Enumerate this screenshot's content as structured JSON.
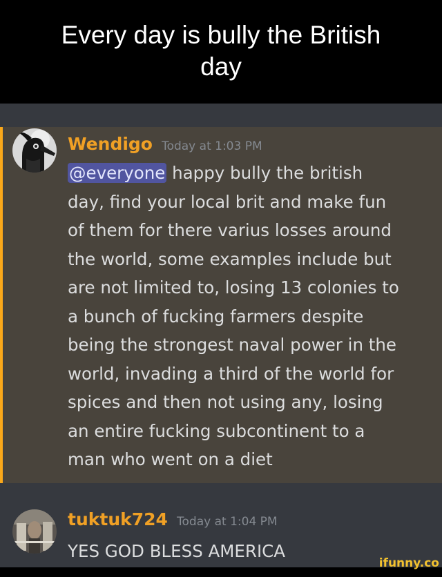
{
  "caption": {
    "line1": "Every day is bully the British",
    "line2": "day"
  },
  "messages": [
    {
      "username": "Wendigo",
      "timestamp": "Today at 1:03 PM",
      "mention": "@everyone",
      "lines": [
        " happy bully the british",
        "day, find your local brit and make fun",
        "of them for there varius losses around",
        "the world, some examples include but",
        "are not limited to, losing 13 colonies to",
        "a bunch of fucking farmers despite",
        "being the strongest naval power in the",
        "world, invading a third of the world for",
        "spices and then not using any, losing",
        "an entire fucking subcontinent to a",
        "man who went on a diet"
      ]
    },
    {
      "username": "tuktuk724",
      "timestamp": "Today at 1:04 PM",
      "lines": [
        "YES GOD BLESS AMERICA"
      ]
    }
  ],
  "watermark": "ifunny.co",
  "colors": {
    "chat_background": "#36393f",
    "mention_highlight_background": "#49443c",
    "mention_highlight_border": "#faa81a",
    "username": "#f0a025",
    "timestamp": "#858a91",
    "body_text": "#dcddde",
    "mention_pill": "#5865f2",
    "watermark": "#f2c12e"
  }
}
